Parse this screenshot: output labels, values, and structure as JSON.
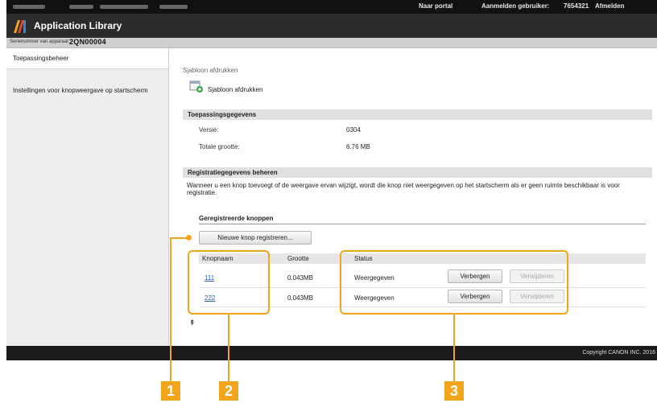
{
  "topbar": {
    "portal_link": "Naar portal",
    "logged_in_label": "Aanmelden gebruiker:",
    "user_id": "7654321",
    "logout_label": "Afmelden"
  },
  "app": {
    "title": "Application Library"
  },
  "device": {
    "serial_label": "Serienummer van apparaat:",
    "serial_value": "2QN00004"
  },
  "sidebar": {
    "items": [
      {
        "label": "Toepassingsbeheer"
      },
      {
        "label": "Instellingen voor knopweergave op startscherm"
      }
    ]
  },
  "main": {
    "breadcrumb": "Sjabloon afdrukken",
    "app_name": "Sjabloon afdrukken",
    "info_section": {
      "title": "Toepassingsgegevens",
      "version_label": "Versie:",
      "version_value": "0304",
      "size_label": "Totale grootte:",
      "size_value": "6.76 MB"
    },
    "registration_section": {
      "title": "Registratiegegevens beheren",
      "description": "Wanneer u een knop toevoegt of de weergave ervan wijzigt, wordt die knop niet weergegeven op het startscherm als er geen ruimte beschikbaar is voor registratie."
    },
    "registered_buttons": {
      "title": "Geregistreerde knoppen",
      "new_button_label": "Nieuwe knop registreren...",
      "columns": [
        "Knopnaam",
        "Grootte",
        "Status"
      ],
      "rows": [
        {
          "name": "111",
          "size": "0.043MB",
          "status": "Weergegeven",
          "hide_label": "Verbergen",
          "delete_label": "Verwijderen"
        },
        {
          "name": "222",
          "size": "0.043MB",
          "status": "Weergegeven",
          "hide_label": "Verbergen",
          "delete_label": "Verwijderen"
        }
      ]
    },
    "to_top_icon": "⇞"
  },
  "footer": {
    "copyright": "Copyright CANON INC. 2016"
  },
  "callouts": {
    "one": "1",
    "two": "2",
    "three": "3"
  },
  "colors": {
    "callout": "#f2a51a",
    "link": "#2a5db0",
    "header_bar": "#2b2b2b",
    "top_bar": "#111111"
  },
  "icons": {
    "logo": "app-library-logo-icon",
    "app": "plugin-app-icon",
    "to_top": "to-top-icon"
  }
}
